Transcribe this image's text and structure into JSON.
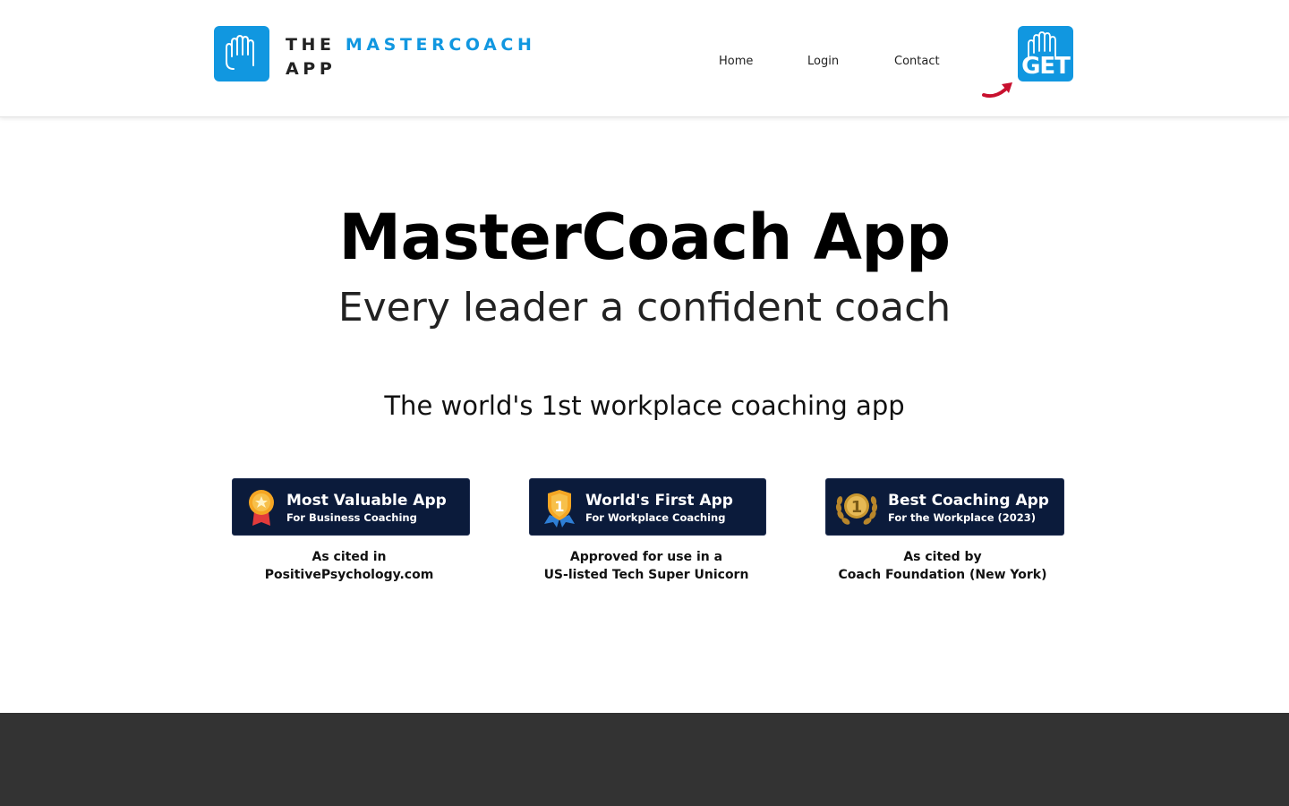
{
  "header": {
    "logo": {
      "line1_part1": "THE",
      "line1_part2": "MASTERCOACH",
      "line2": "APP",
      "icon": "hand-logo-icon"
    },
    "nav": {
      "home": "Home",
      "login": "Login",
      "contact": "Contact"
    },
    "get_button": {
      "label": "GET",
      "icon": "hand-logo-icon"
    },
    "arrow_icon": "curved-arrow-icon"
  },
  "hero": {
    "title": "MasterCoach App",
    "subtitle": "Every leader a confident coach",
    "tagline": "The world's 1st workplace coaching app"
  },
  "badges": [
    {
      "title": "Most Valuable App",
      "subtitle": "For Business Coaching",
      "caption_line1": "As cited in",
      "caption_line2": "PositivePsychology.com",
      "icon": "gold-medal-icon"
    },
    {
      "title": "World's First App",
      "subtitle": "For Workplace Coaching",
      "caption_line1": "Approved for use in a",
      "caption_line2": "US-listed Tech Super Unicorn",
      "icon": "number-one-shield-icon"
    },
    {
      "title": "Best Coaching App",
      "subtitle": "For the Workplace (2023)",
      "caption_line1": "As cited by",
      "caption_line2": "Coach Foundation (New York)",
      "icon": "laurel-medal-icon"
    }
  ],
  "colors": {
    "brand_blue": "#1197e0",
    "badge_navy": "#0b1b3b",
    "footer_gray": "#333333",
    "arrow_red": "#c8102e"
  }
}
